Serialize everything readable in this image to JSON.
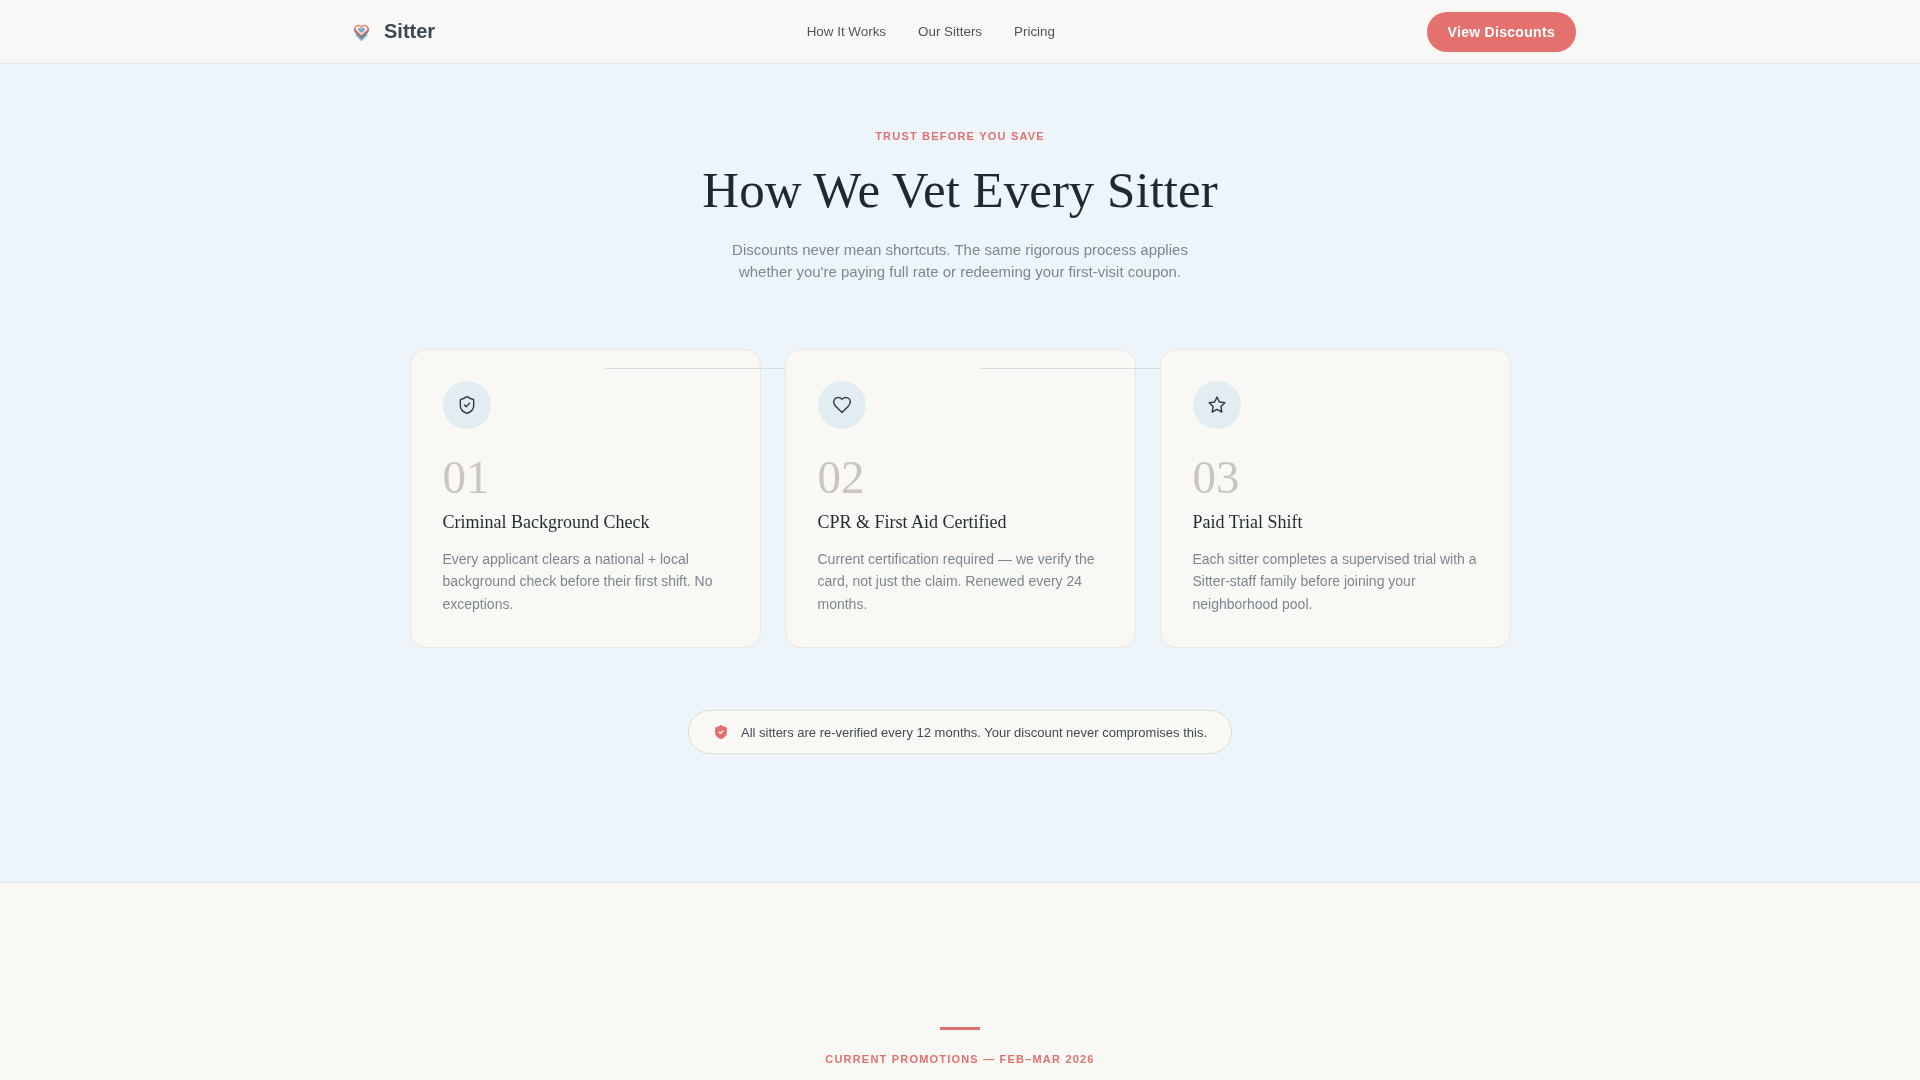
{
  "header": {
    "brand": "Sitter",
    "nav": [
      "How It Works",
      "Our Sitters",
      "Pricing"
    ],
    "cta": "View Discounts"
  },
  "hero": {
    "eyebrow": "TRUST BEFORE YOU SAVE",
    "title": "How We Vet Every Sitter",
    "subtitle": "Discounts never mean shortcuts. The same rigorous process applies whether you're paying full rate or redeeming your first-visit coupon."
  },
  "steps": [
    {
      "number": "01",
      "title": "Criminal Background Check",
      "description": "Every applicant clears a national + local background check before their first shift. No exceptions."
    },
    {
      "number": "02",
      "title": "CPR & First Aid Certified",
      "description": "Current certification required — we verify the card, not just the claim. Renewed every 24 months."
    },
    {
      "number": "03",
      "title": "Paid Trial Shift",
      "description": "Each sitter completes a supervised trial with a Sitter-staff family before joining your neighborhood pool."
    }
  ],
  "notice": {
    "text": "All sitters are re-verified every 12 months. Your discount never compromises this."
  },
  "promotions": {
    "eyebrow": "CURRENT PROMOTIONS — FEB–MAR 2026"
  }
}
